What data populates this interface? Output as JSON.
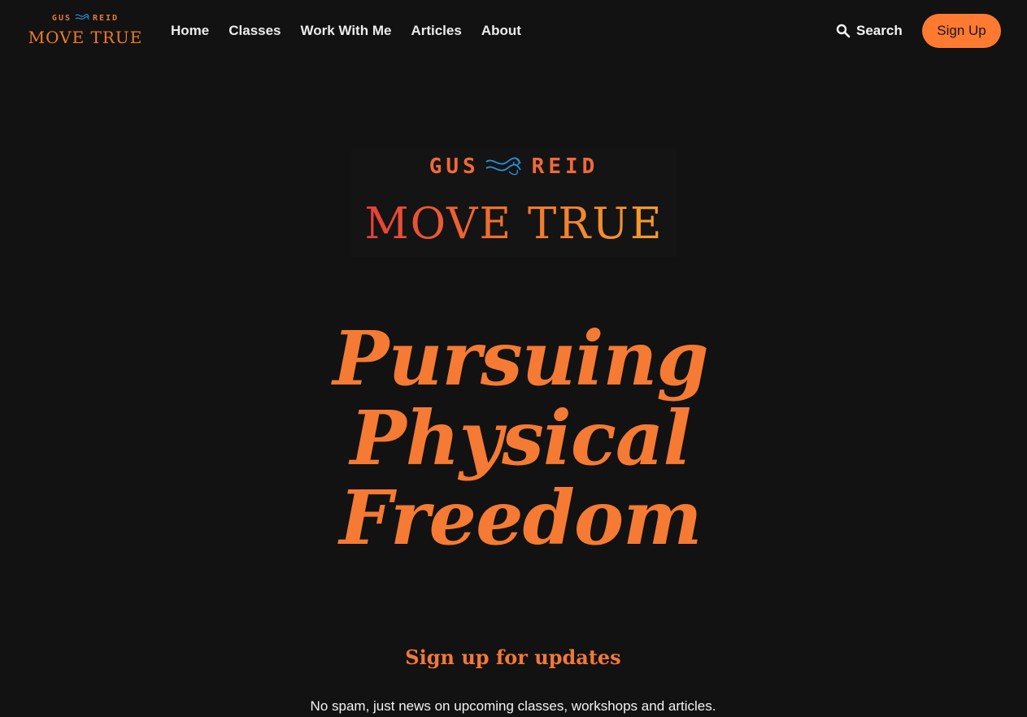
{
  "header": {
    "logo": {
      "top_left": "GUS",
      "top_right": "REID",
      "title": "MOVE TRUE"
    },
    "nav": [
      "Home",
      "Classes",
      "Work With Me",
      "Articles",
      "About"
    ],
    "search_label": "Search",
    "signup_label": "Sign Up"
  },
  "hero": {
    "logo": {
      "top_left": "GUS",
      "top_right": "REID",
      "title": "MOVE TRUE"
    },
    "headline_lines": [
      "Pursuing",
      "Physical",
      "Freedom"
    ]
  },
  "signup_section": {
    "title": "Sign up for updates",
    "subtitle": "No spam, just news on upcoming classes, workshops and articles."
  },
  "colors": {
    "background": "#121212",
    "accent": "#fe7a31",
    "headline": "#f57a33",
    "logo_wave": "#2b8fd6"
  },
  "icons": {
    "search": "search-icon",
    "logo_wave": "wave-icon"
  }
}
